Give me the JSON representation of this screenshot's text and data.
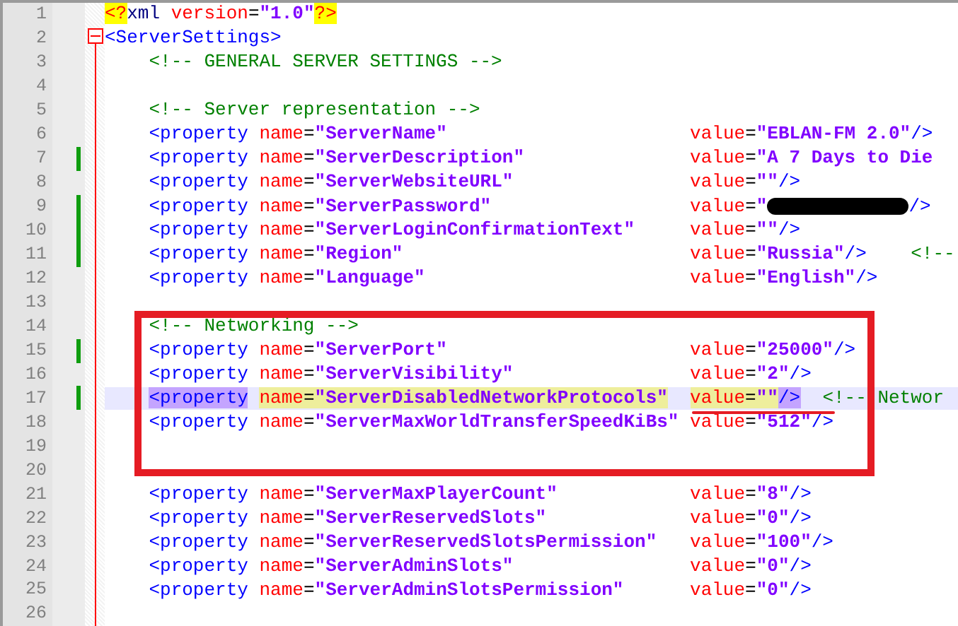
{
  "editor": {
    "lines": [
      {
        "number": "1",
        "changed": false,
        "current": false,
        "tokens": [
          {
            "kind": "pi",
            "text": "<?"
          },
          {
            "kind": "name",
            "text": "xml"
          },
          {
            "kind": "attr",
            "text": " version"
          },
          {
            "kind": "punct",
            "text": "="
          },
          {
            "kind": "value",
            "text": "\"1.0\""
          },
          {
            "kind": "pi",
            "text": "?>"
          }
        ]
      },
      {
        "number": "2",
        "changed": false,
        "current": false,
        "fold": true,
        "tokens": [
          {
            "kind": "tag",
            "text": "<ServerSettings>"
          }
        ]
      },
      {
        "number": "3",
        "changed": false,
        "current": false,
        "tokens": [
          {
            "kind": "comment",
            "text": "    <!-- GENERAL SERVER SETTINGS -->"
          }
        ]
      },
      {
        "number": "4",
        "changed": false,
        "current": false
      },
      {
        "number": "5",
        "changed": false,
        "current": false,
        "tokens": [
          {
            "kind": "comment",
            "text": "    <!-- Server representation -->"
          }
        ]
      },
      {
        "number": "6",
        "changed": false,
        "current": false,
        "tokens": [
          {
            "kind": "tag",
            "text": "    <property"
          },
          {
            "kind": "attr",
            "text": " name"
          },
          {
            "kind": "punct",
            "text": "="
          },
          {
            "kind": "value",
            "text": "\"ServerName\""
          },
          {
            "kind": "attr",
            "text": "                      value"
          },
          {
            "kind": "punct",
            "text": "="
          },
          {
            "kind": "value",
            "text": "\"EBLAN-FM 2.0\""
          },
          {
            "kind": "tag",
            "text": "/>"
          }
        ]
      },
      {
        "number": "7",
        "changed": true,
        "current": false,
        "tokens": [
          {
            "kind": "tag",
            "text": "    <property"
          },
          {
            "kind": "attr",
            "text": " name"
          },
          {
            "kind": "punct",
            "text": "="
          },
          {
            "kind": "value",
            "text": "\"ServerDescription\""
          },
          {
            "kind": "attr",
            "text": "               value"
          },
          {
            "kind": "punct",
            "text": "="
          },
          {
            "kind": "value",
            "text": "\"A 7 Days to Die"
          }
        ]
      },
      {
        "number": "8",
        "changed": false,
        "current": false,
        "tokens": [
          {
            "kind": "tag",
            "text": "    <property"
          },
          {
            "kind": "attr",
            "text": " name"
          },
          {
            "kind": "punct",
            "text": "="
          },
          {
            "kind": "value",
            "text": "\"ServerWebsiteURL\""
          },
          {
            "kind": "attr",
            "text": "                value"
          },
          {
            "kind": "punct",
            "text": "="
          },
          {
            "kind": "value",
            "text": "\"\""
          },
          {
            "kind": "tag",
            "text": "/>"
          }
        ]
      },
      {
        "number": "9",
        "changed": true,
        "current": false,
        "tokens": [
          {
            "kind": "tag",
            "text": "    <property"
          },
          {
            "kind": "attr",
            "text": " name"
          },
          {
            "kind": "punct",
            "text": "="
          },
          {
            "kind": "value",
            "text": "\"ServerPassword\""
          },
          {
            "kind": "attr",
            "text": "                  value"
          },
          {
            "kind": "punct",
            "text": "="
          },
          {
            "kind": "value",
            "text": "\""
          },
          {
            "kind": "redacted"
          },
          {
            "kind": "tag",
            "text": "/>"
          }
        ]
      },
      {
        "number": "10",
        "changed": true,
        "current": false,
        "tokens": [
          {
            "kind": "tag",
            "text": "    <property"
          },
          {
            "kind": "attr",
            "text": " name"
          },
          {
            "kind": "punct",
            "text": "="
          },
          {
            "kind": "value",
            "text": "\"ServerLoginConfirmationText\""
          },
          {
            "kind": "attr",
            "text": "     value"
          },
          {
            "kind": "punct",
            "text": "="
          },
          {
            "kind": "value",
            "text": "\"\""
          },
          {
            "kind": "tag",
            "text": "/>"
          }
        ]
      },
      {
        "number": "11",
        "changed": true,
        "current": false,
        "tokens": [
          {
            "kind": "tag",
            "text": "    <property"
          },
          {
            "kind": "attr",
            "text": " name"
          },
          {
            "kind": "punct",
            "text": "="
          },
          {
            "kind": "value",
            "text": "\"Region\""
          },
          {
            "kind": "attr",
            "text": "                          value"
          },
          {
            "kind": "punct",
            "text": "="
          },
          {
            "kind": "value",
            "text": "\"Russia\""
          },
          {
            "kind": "tag",
            "text": "/>"
          },
          {
            "kind": "comment",
            "text": "    <!--"
          }
        ]
      },
      {
        "number": "12",
        "changed": false,
        "current": false,
        "tokens": [
          {
            "kind": "tag",
            "text": "    <property"
          },
          {
            "kind": "attr",
            "text": " name"
          },
          {
            "kind": "punct",
            "text": "="
          },
          {
            "kind": "value",
            "text": "\"Language\""
          },
          {
            "kind": "attr",
            "text": "                        value"
          },
          {
            "kind": "punct",
            "text": "="
          },
          {
            "kind": "value",
            "text": "\"English\""
          },
          {
            "kind": "tag",
            "text": "/>"
          }
        ]
      },
      {
        "number": "13",
        "changed": false,
        "current": false
      },
      {
        "number": "14",
        "changed": false,
        "current": false,
        "tokens": [
          {
            "kind": "comment",
            "text": "    <!-- Networking -->"
          }
        ]
      },
      {
        "number": "15",
        "changed": true,
        "current": false,
        "tokens": [
          {
            "kind": "tag",
            "text": "    <property"
          },
          {
            "kind": "attr",
            "text": " name"
          },
          {
            "kind": "punct",
            "text": "="
          },
          {
            "kind": "value",
            "text": "\"ServerPort\""
          },
          {
            "kind": "attr",
            "text": "                      value"
          },
          {
            "kind": "punct",
            "text": "="
          },
          {
            "kind": "value",
            "text": "\"25000\""
          },
          {
            "kind": "tag",
            "text": "/>"
          }
        ]
      },
      {
        "number": "16",
        "changed": false,
        "current": false,
        "tokens": [
          {
            "kind": "tag",
            "text": "    <property"
          },
          {
            "kind": "attr",
            "text": " name"
          },
          {
            "kind": "punct",
            "text": "="
          },
          {
            "kind": "value",
            "text": "\"ServerVisibility\""
          },
          {
            "kind": "attr",
            "text": "                value"
          },
          {
            "kind": "punct",
            "text": "="
          },
          {
            "kind": "value",
            "text": "\"2\""
          },
          {
            "kind": "tag",
            "text": "/>"
          }
        ]
      },
      {
        "number": "17",
        "changed": true,
        "current": true,
        "tokens": [
          {
            "kind": "tag",
            "text": "    <property",
            "selected": true,
            "matched": false
          },
          {
            "kind": "attr",
            "text": " name",
            "selected": false,
            "matched": true
          },
          {
            "kind": "punct",
            "text": "=",
            "selected": false,
            "matched": true
          },
          {
            "kind": "value",
            "text": "\"ServerDisabledNetworkProtocols\"",
            "selected": false,
            "matched": true
          },
          {
            "kind": "attr",
            "text": "  value",
            "selected": false,
            "matched": true
          },
          {
            "kind": "punct",
            "text": "=",
            "selected": false,
            "matched": true
          },
          {
            "kind": "value",
            "text": "\"\"",
            "selected": false,
            "matched": true
          },
          {
            "kind": "tag",
            "text": "/>",
            "selected": true,
            "matched": false
          },
          {
            "kind": "comment",
            "text": "  <!-- Networ"
          }
        ]
      },
      {
        "number": "18",
        "changed": false,
        "current": false,
        "tokens": [
          {
            "kind": "tag",
            "text": "    <property"
          },
          {
            "kind": "attr",
            "text": " name"
          },
          {
            "kind": "punct",
            "text": "="
          },
          {
            "kind": "value",
            "text": "\"ServerMaxWorldTransferSpeedKiBs\""
          },
          {
            "kind": "attr",
            "text": " value"
          },
          {
            "kind": "punct",
            "text": "="
          },
          {
            "kind": "value",
            "text": "\"512\""
          },
          {
            "kind": "tag",
            "text": "/>"
          }
        ]
      },
      {
        "number": "19",
        "changed": false,
        "current": false
      },
      {
        "number": "20",
        "changed": false,
        "current": false
      },
      {
        "number": "21",
        "changed": false,
        "current": false,
        "tokens": [
          {
            "kind": "tag",
            "text": "    <property"
          },
          {
            "kind": "attr",
            "text": " name"
          },
          {
            "kind": "punct",
            "text": "="
          },
          {
            "kind": "value",
            "text": "\"ServerMaxPlayerCount\""
          },
          {
            "kind": "attr",
            "text": "            value"
          },
          {
            "kind": "punct",
            "text": "="
          },
          {
            "kind": "value",
            "text": "\"8\""
          },
          {
            "kind": "tag",
            "text": "/>"
          }
        ]
      },
      {
        "number": "22",
        "changed": false,
        "current": false,
        "tokens": [
          {
            "kind": "tag",
            "text": "    <property"
          },
          {
            "kind": "attr",
            "text": " name"
          },
          {
            "kind": "punct",
            "text": "="
          },
          {
            "kind": "value",
            "text": "\"ServerReservedSlots\""
          },
          {
            "kind": "attr",
            "text": "             value"
          },
          {
            "kind": "punct",
            "text": "="
          },
          {
            "kind": "value",
            "text": "\"0\""
          },
          {
            "kind": "tag",
            "text": "/>"
          }
        ]
      },
      {
        "number": "23",
        "changed": false,
        "current": false,
        "tokens": [
          {
            "kind": "tag",
            "text": "    <property"
          },
          {
            "kind": "attr",
            "text": " name"
          },
          {
            "kind": "punct",
            "text": "="
          },
          {
            "kind": "value",
            "text": "\"ServerReservedSlotsPermission\""
          },
          {
            "kind": "attr",
            "text": "   value"
          },
          {
            "kind": "punct",
            "text": "="
          },
          {
            "kind": "value",
            "text": "\"100\""
          },
          {
            "kind": "tag",
            "text": "/>"
          }
        ]
      },
      {
        "number": "24",
        "changed": false,
        "current": false,
        "tokens": [
          {
            "kind": "tag",
            "text": "    <property"
          },
          {
            "kind": "attr",
            "text": " name"
          },
          {
            "kind": "punct",
            "text": "="
          },
          {
            "kind": "value",
            "text": "\"ServerAdminSlots\""
          },
          {
            "kind": "attr",
            "text": "                value"
          },
          {
            "kind": "punct",
            "text": "="
          },
          {
            "kind": "value",
            "text": "\"0\""
          },
          {
            "kind": "tag",
            "text": "/>"
          }
        ]
      },
      {
        "number": "25",
        "changed": false,
        "current": false,
        "tokens": [
          {
            "kind": "tag",
            "text": "    <property"
          },
          {
            "kind": "attr",
            "text": " name"
          },
          {
            "kind": "punct",
            "text": "="
          },
          {
            "kind": "value",
            "text": "\"ServerAdminSlotsPermission\""
          },
          {
            "kind": "attr",
            "text": "      value"
          },
          {
            "kind": "punct",
            "text": "="
          },
          {
            "kind": "value",
            "text": "\"0\""
          },
          {
            "kind": "tag",
            "text": "/>"
          }
        ]
      },
      {
        "number": "26",
        "changed": false,
        "current": false
      }
    ]
  },
  "markup": {
    "box": true,
    "underline": true
  }
}
